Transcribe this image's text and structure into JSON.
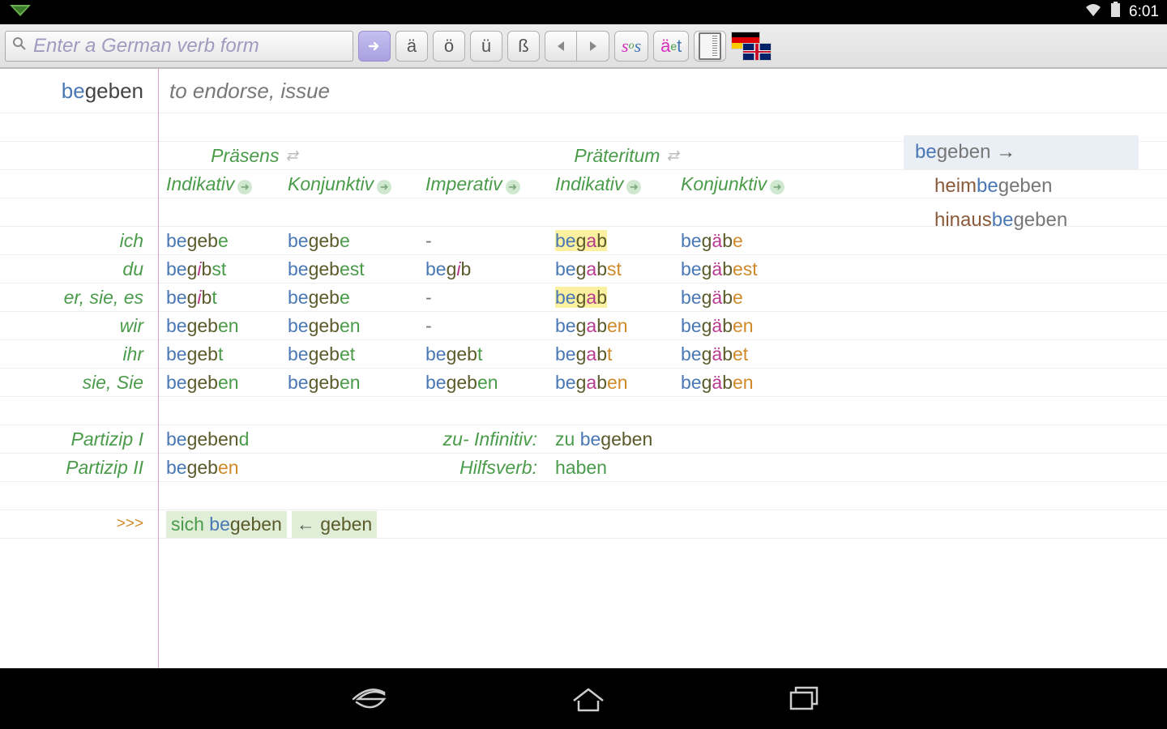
{
  "status": {
    "time": "6:01"
  },
  "toolbar": {
    "search_placeholder": "Enter a German verb form",
    "char_buttons": [
      "ä",
      "ö",
      "ü",
      "ß"
    ]
  },
  "headword": {
    "prefix": "be",
    "stem": "geben"
  },
  "translation": "to endorse, issue",
  "tenses": {
    "left": "Präsens",
    "right": "Präteritum"
  },
  "moods": {
    "ind": "Indikativ",
    "konj": "Konjunktiv",
    "imp": "Imperativ"
  },
  "pronouns": [
    "ich",
    "du",
    "er, sie, es",
    "wir",
    "ihr",
    "sie, Sie"
  ],
  "extras": {
    "partizip1_label": "Partizip I",
    "partizip2_label": "Partizip II",
    "zu_inf_label": "zu- Infinitiv:",
    "hilfsverb_label": "Hilfsverb:",
    "hilfsverb_value": "haben",
    "more": ">>>",
    "sich": "sich",
    "back_arrow": "←",
    "root": "geben"
  },
  "related": {
    "head": {
      "prefix": "be",
      "stem": "geben",
      "arrow": "→"
    },
    "items": [
      {
        "pre": "heim",
        "mid": "be",
        "stem": "geben"
      },
      {
        "pre": "hinaus",
        "mid": "be",
        "stem": "geben"
      }
    ]
  }
}
